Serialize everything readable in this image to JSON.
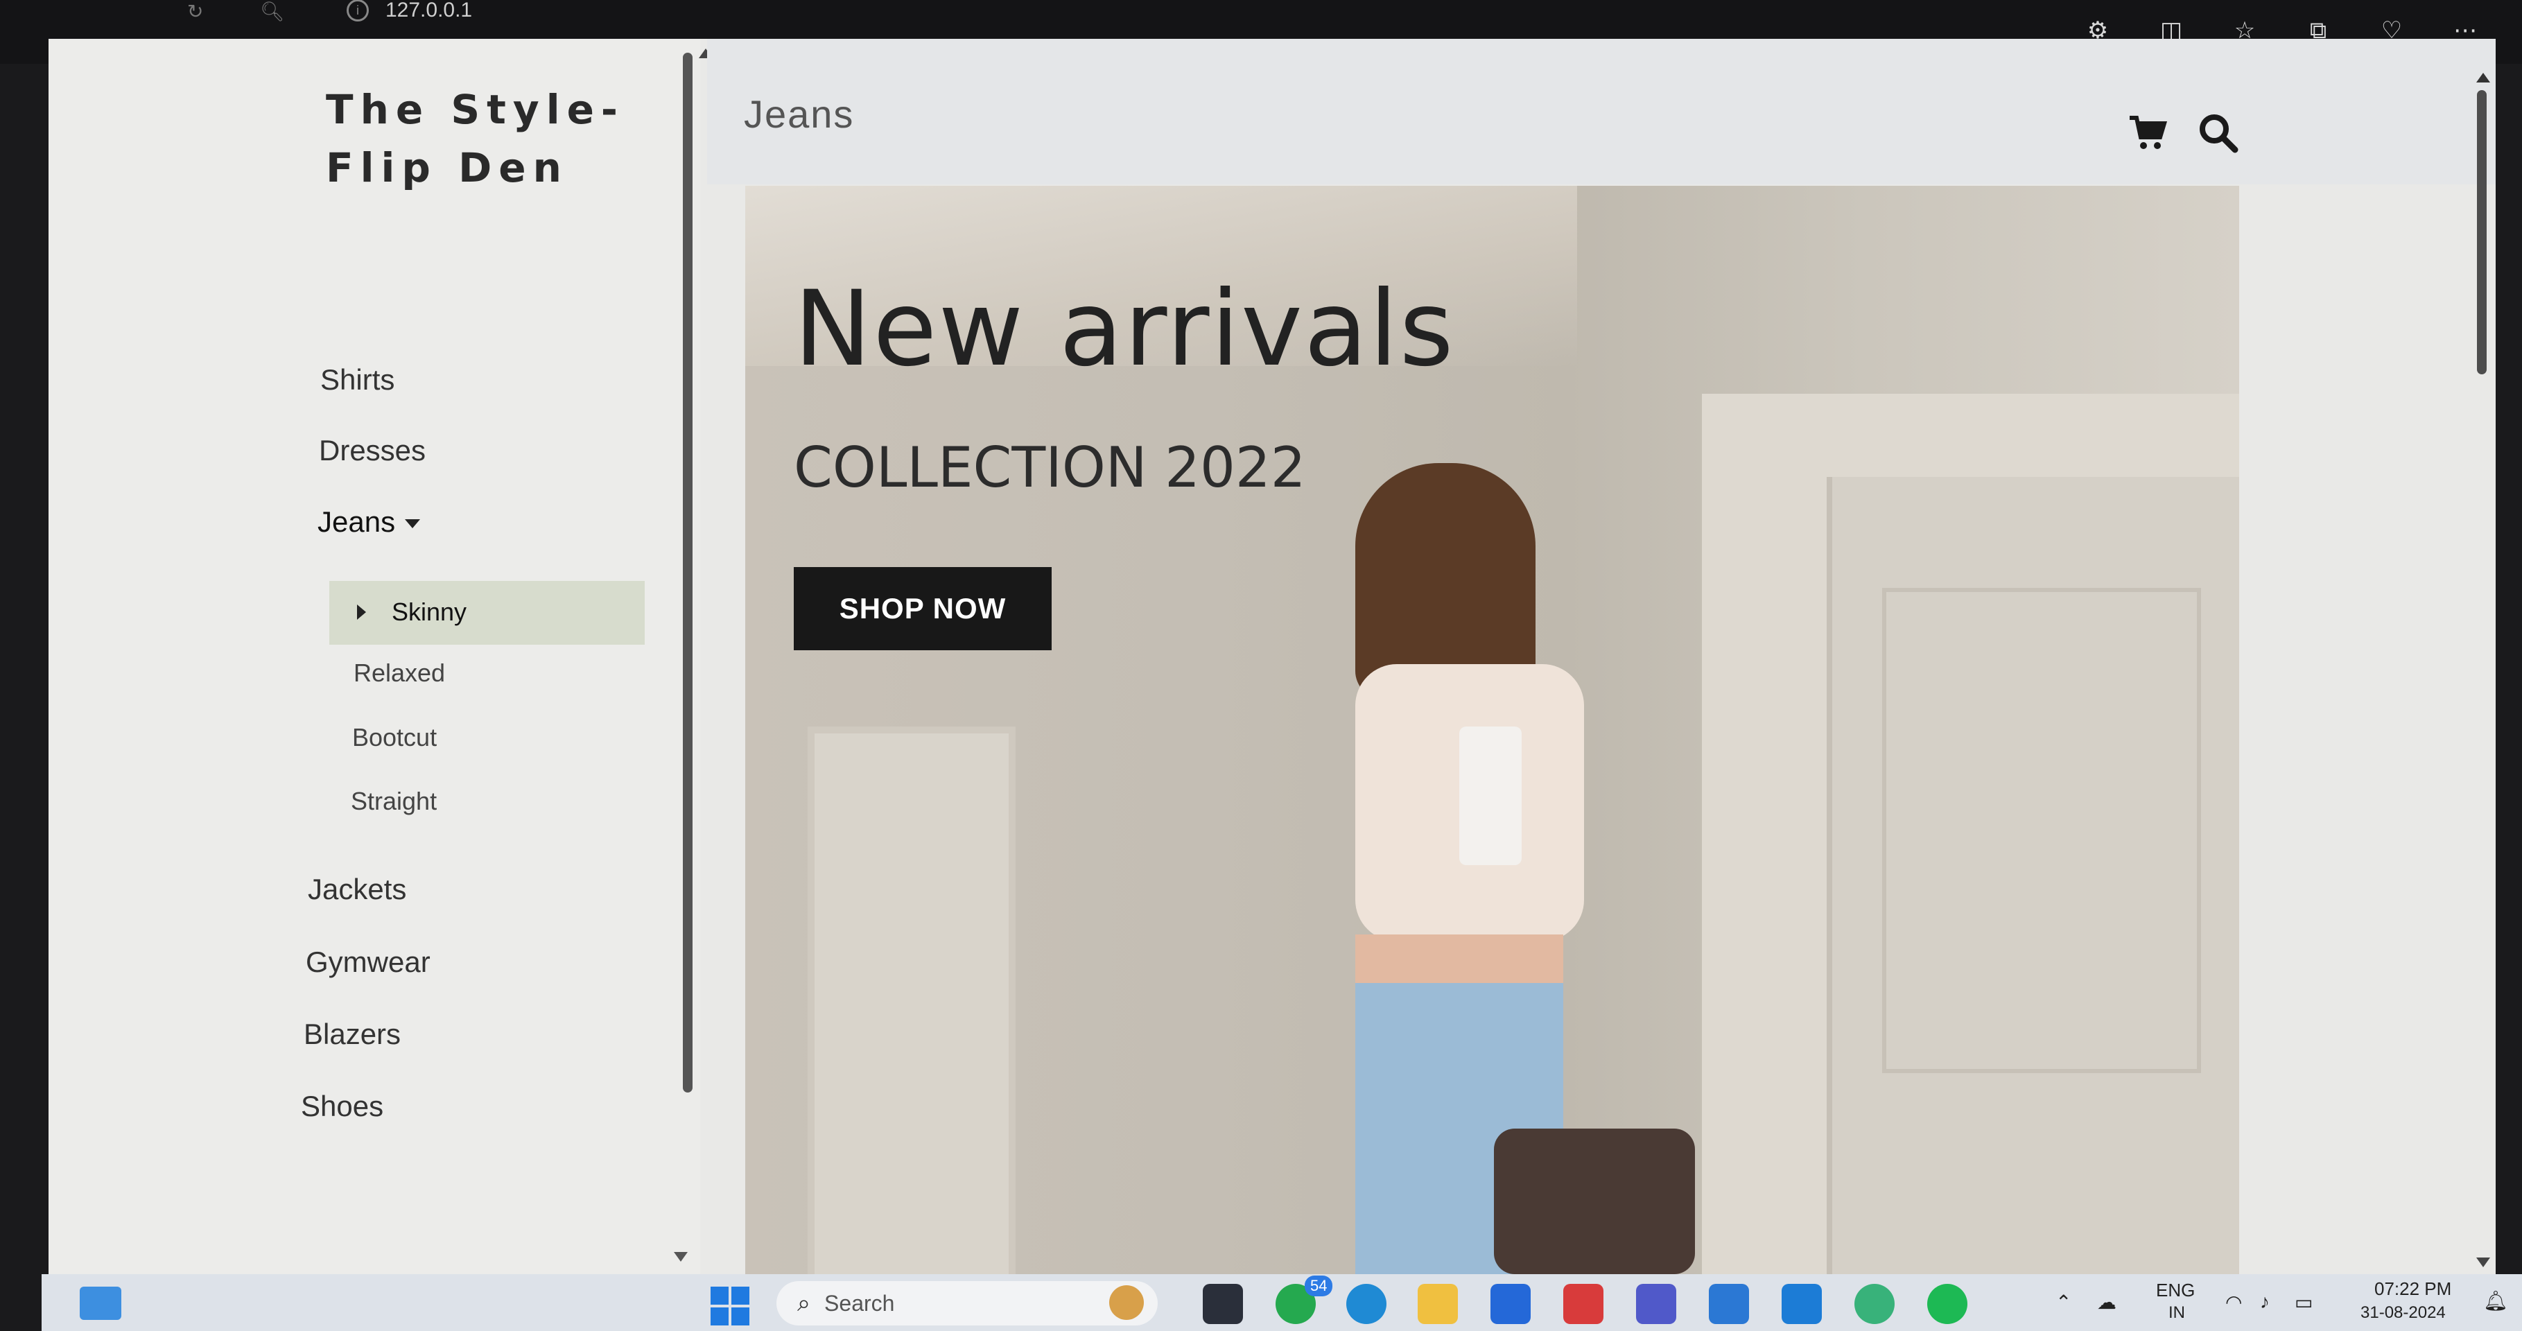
{
  "browser": {
    "url": "127.0.0.1",
    "tool_icons": [
      "extensions-icon",
      "split-screen-icon",
      "favorites-icon",
      "collections-icon",
      "browser-essentials-icon",
      "more-icon"
    ]
  },
  "sidebar": {
    "brand": "The Style-\nFlip Den",
    "items": [
      {
        "label": "Shirts"
      },
      {
        "label": "Dresses"
      },
      {
        "label": "Jeans"
      },
      {
        "label": "Jackets"
      },
      {
        "label": "Gymwear"
      },
      {
        "label": "Blazers"
      },
      {
        "label": "Shoes"
      }
    ],
    "jeans_submenu": [
      {
        "label": "Skinny"
      },
      {
        "label": "Relaxed"
      },
      {
        "label": "Bootcut"
      },
      {
        "label": "Straight"
      }
    ]
  },
  "header": {
    "title": "Jeans"
  },
  "hero": {
    "title": "New arrivals",
    "subtitle": "COLLECTION 2022",
    "button": "SHOP NOW"
  },
  "taskbar": {
    "search_placeholder": "Search",
    "whatsapp_badge": "54",
    "lang": "ENG",
    "lang_region": "IN",
    "time": "07:22 PM",
    "date": "31-08-2024"
  },
  "colors": {
    "submenu_active_bg": "#d7dccd",
    "button_bg": "#181818",
    "taskbar_bg": "#dde2e9"
  }
}
